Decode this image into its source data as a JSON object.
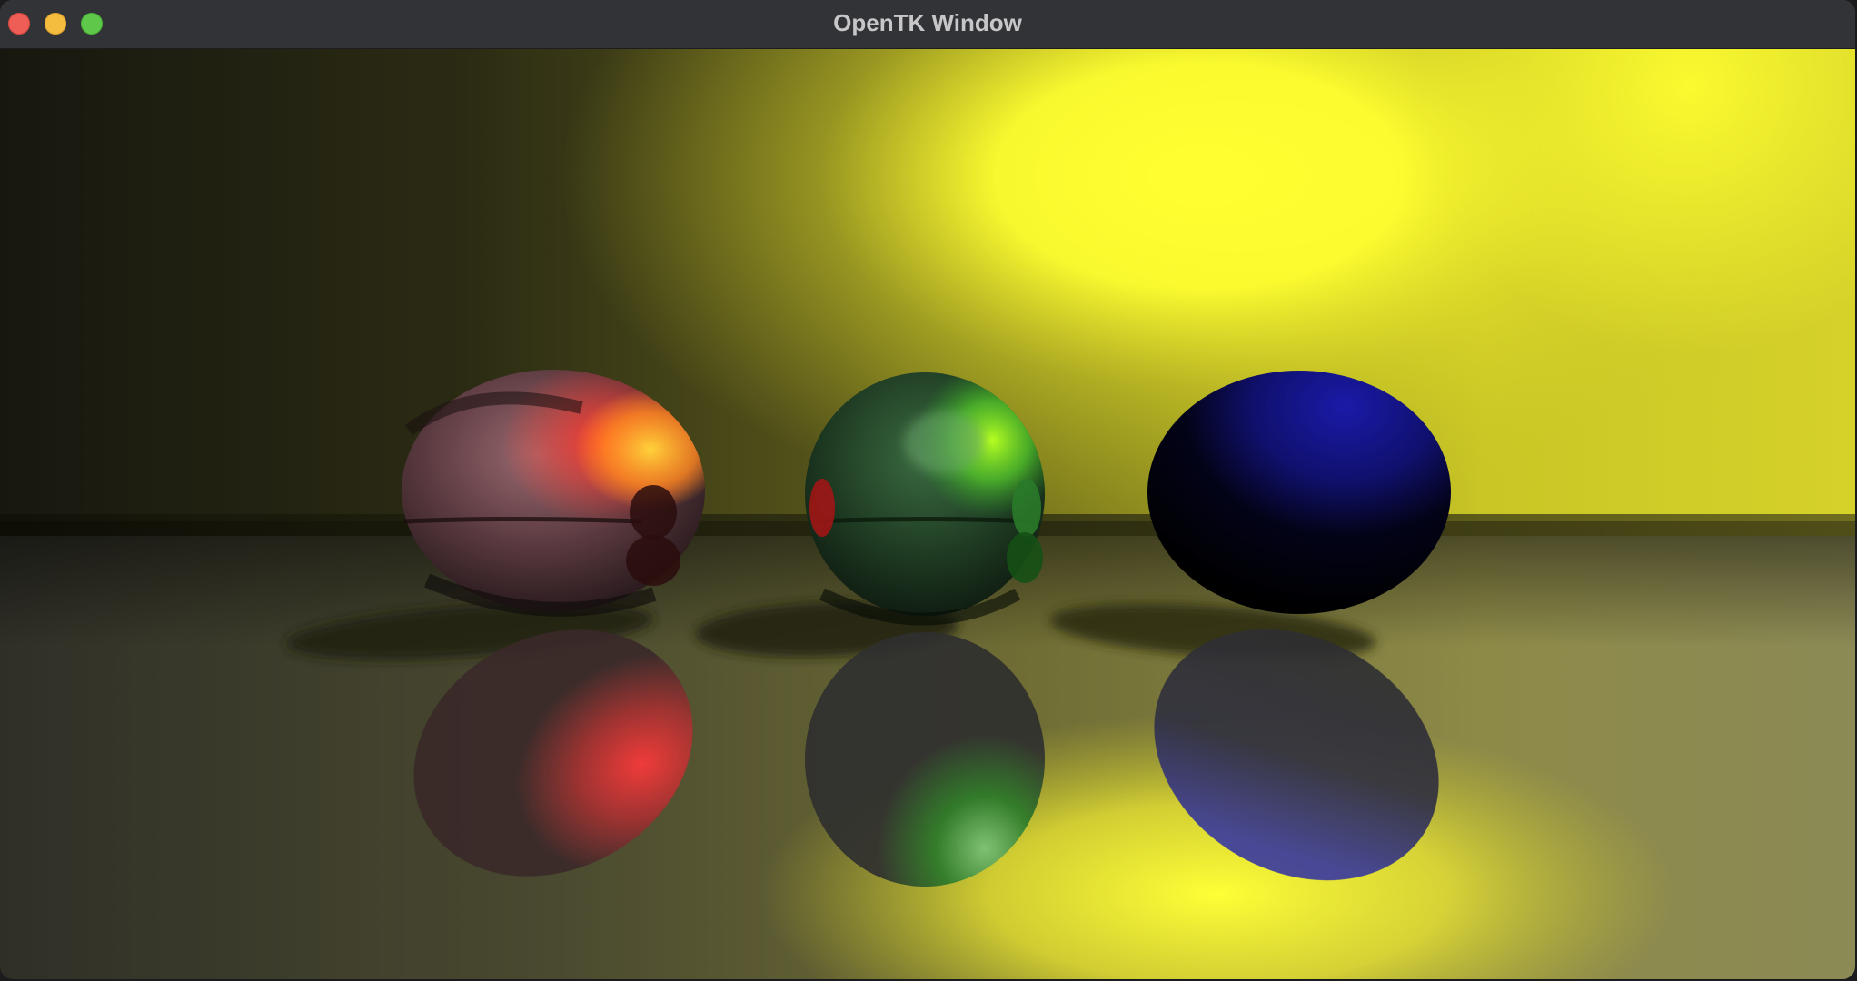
{
  "window": {
    "title": "OpenTK Window"
  },
  "controls": {
    "close": "close",
    "minimize": "minimize",
    "maximize": "maximize"
  },
  "scene": {
    "light_color": "#ffff30",
    "spheres": [
      {
        "name": "red-sphere",
        "color": "#d32a2a"
      },
      {
        "name": "green-sphere",
        "color": "#2aa02a"
      },
      {
        "name": "blue-sphere",
        "color": "#1a1a90"
      }
    ]
  }
}
